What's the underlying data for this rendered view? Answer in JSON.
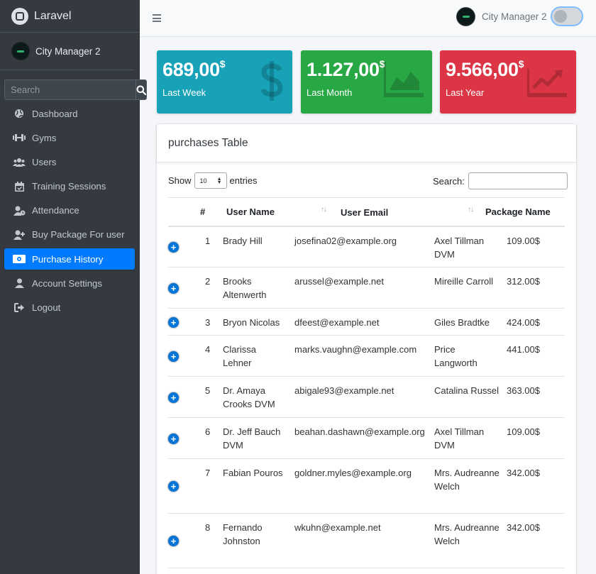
{
  "brand": "Laravel",
  "sidebar": {
    "user_name": "City Manager 2",
    "search_placeholder": "Search",
    "items": [
      {
        "label": "Dashboard",
        "icon": "globe-icon"
      },
      {
        "label": "Gyms",
        "icon": "dumbbell-icon"
      },
      {
        "label": "Users",
        "icon": "users-icon"
      },
      {
        "label": "Training Sessions",
        "icon": "calendar-icon"
      },
      {
        "label": "Attendance",
        "icon": "user-clock-icon"
      },
      {
        "label": "Buy Package For user",
        "icon": "user-plus-icon"
      },
      {
        "label": "Purchase History",
        "icon": "money-bill-icon",
        "active": true
      },
      {
        "label": "Account Settings",
        "icon": "user-icon"
      },
      {
        "label": "Logout",
        "icon": "logout-icon"
      }
    ]
  },
  "topbar": {
    "user_name": "City Manager 2"
  },
  "stats": [
    {
      "value": "689,00",
      "unit": "$",
      "label": "Last Week",
      "color": "#17a2b8",
      "icon": "dollar-icon"
    },
    {
      "value": "1.127,00",
      "unit": "$",
      "label": "Last Month",
      "color": "#28a745",
      "icon": "area-chart-icon"
    },
    {
      "value": "9.566,00",
      "unit": "$",
      "label": "Last Year",
      "color": "#dc3545",
      "icon": "line-chart-icon"
    }
  ],
  "card": {
    "title": "purchases Table",
    "show_label": "Show",
    "entries_value": "10",
    "entries_label": "entries",
    "search_label": "Search:"
  },
  "table": {
    "headers": [
      "#",
      "User Name",
      "User Email",
      "Package Name"
    ],
    "rows": [
      {
        "id": "1",
        "name": "Brady Hill",
        "email": "josefina02@example.org",
        "package": "Axel Tillman DVM",
        "price": "109.00$"
      },
      {
        "id": "2",
        "name": "Brooks Altenwerth",
        "email": "arussel@example.net",
        "package": "Mireille Carroll",
        "price": "312.00$"
      },
      {
        "id": "3",
        "name": "Bryon Nicolas",
        "email": "dfeest@example.net",
        "package": "Giles Bradtke",
        "price": "424.00$"
      },
      {
        "id": "4",
        "name": "Clarissa Lehner",
        "email": "marks.vaughn@example.com",
        "package": "Price Langworth",
        "price": "441.00$"
      },
      {
        "id": "5",
        "name": "Dr. Amaya Crooks DVM",
        "email": "abigale93@example.net",
        "package": "Catalina Russel",
        "price": "363.00$"
      },
      {
        "id": "6",
        "name": "Dr. Jeff Bauch DVM",
        "email": "beahan.dashawn@example.org",
        "package": "Axel Tillman DVM",
        "price": "109.00$"
      },
      {
        "id": "7",
        "name": "Fabian Pouros",
        "email": "goldner.myles@example.org",
        "package": "Mrs. Audreanne Welch",
        "price": "342.00$"
      },
      {
        "id": "8",
        "name": "Fernando Johnston",
        "email": "wkuhn@example.net",
        "package": "Mrs. Audreanne Welch",
        "price": "342.00$"
      }
    ]
  }
}
